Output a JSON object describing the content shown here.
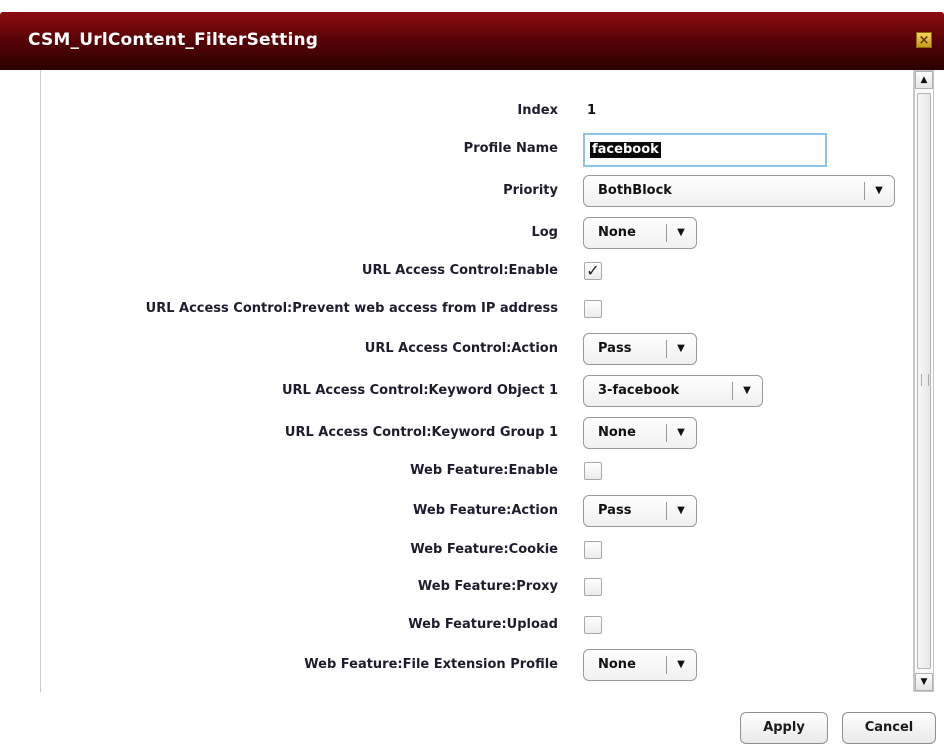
{
  "dialog": {
    "title": "CSM_UrlContent_FilterSetting",
    "close_symbol": "×"
  },
  "form": {
    "index": {
      "label": "Index",
      "value": "1"
    },
    "profile_name": {
      "label": "Profile Name",
      "value": "facebook"
    },
    "priority": {
      "label": "Priority",
      "value": "BothBlock"
    },
    "log": {
      "label": "Log",
      "value": "None"
    },
    "url_enable": {
      "label": "URL Access Control:Enable",
      "checked": true
    },
    "url_prevent_ip": {
      "label": "URL Access Control:Prevent web access from IP address",
      "checked": false
    },
    "url_action": {
      "label": "URL Access Control:Action",
      "value": "Pass"
    },
    "url_keyword_object": {
      "label": "URL Access Control:Keyword Object 1",
      "value": "3-facebook"
    },
    "url_keyword_group": {
      "label": "URL Access Control:Keyword Group 1",
      "value": "None"
    },
    "web_enable": {
      "label": "Web Feature:Enable",
      "checked": false
    },
    "web_action": {
      "label": "Web Feature:Action",
      "value": "Pass"
    },
    "web_cookie": {
      "label": "Web Feature:Cookie",
      "checked": false
    },
    "web_proxy": {
      "label": "Web Feature:Proxy",
      "checked": false
    },
    "web_upload": {
      "label": "Web Feature:Upload",
      "checked": false
    },
    "web_file_ext": {
      "label": "Web Feature:File Extension Profile",
      "value": "None"
    }
  },
  "symbols": {
    "dropdown_arrow": "▼",
    "scroll_up": "▲",
    "scroll_down": "▼",
    "check": "✓"
  },
  "footer": {
    "apply_label": "Apply",
    "cancel_label": "Cancel"
  },
  "icons": [
    "close-icon",
    "chevron-down-icon",
    "check-icon",
    "scroll-up-icon",
    "scroll-down-icon"
  ],
  "colors": {
    "title_bar": "#5a0306",
    "focus_border": "#8cc3e8",
    "close_button": "#f6d35a"
  }
}
